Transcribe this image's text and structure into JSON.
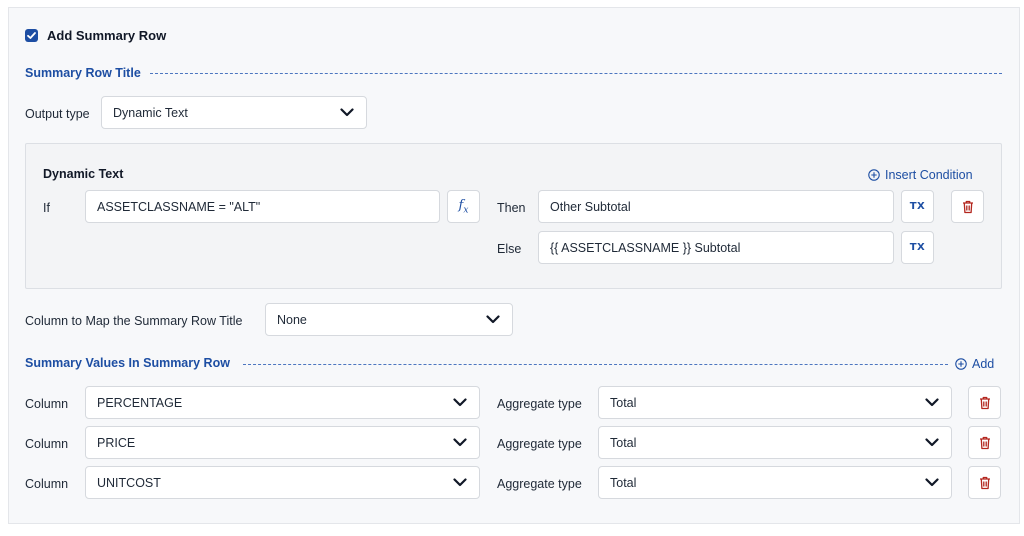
{
  "add_summary_row": {
    "label": "Add Summary Row",
    "checked": true
  },
  "summary_row_title": {
    "heading": "Summary Row Title"
  },
  "output_type": {
    "label": "Output type",
    "value": "Dynamic Text"
  },
  "dynamic_text": {
    "heading": "Dynamic Text",
    "insert_condition_label": "Insert Condition",
    "if_label": "If",
    "condition_value": "ASSETCLASSNAME = \"ALT\"",
    "fx_icon": "fx",
    "then_label": "Then",
    "then_value": "Other Subtotal",
    "else_label": "Else",
    "else_value": "{{ ASSETCLASSNAME }} Subtotal",
    "tx_icon": "TX"
  },
  "map_column": {
    "label": "Column to Map the Summary Row Title",
    "value": "None"
  },
  "summary_values": {
    "heading": "Summary Values In Summary Row",
    "add_label": "Add",
    "rows": [
      {
        "column_label": "Column",
        "column_value": "PERCENTAGE",
        "aggregate_label": "Aggregate type",
        "aggregate_value": "Total"
      },
      {
        "column_label": "Column",
        "column_value": "PRICE",
        "aggregate_label": "Aggregate type",
        "aggregate_value": "Total"
      },
      {
        "column_label": "Column",
        "column_value": "UNITCOST",
        "aggregate_label": "Aggregate type",
        "aggregate_value": "Total"
      }
    ]
  },
  "colors": {
    "accent": "#1d4ea3",
    "danger": "#b3261e",
    "panel_bg": "#f7f8fa"
  }
}
